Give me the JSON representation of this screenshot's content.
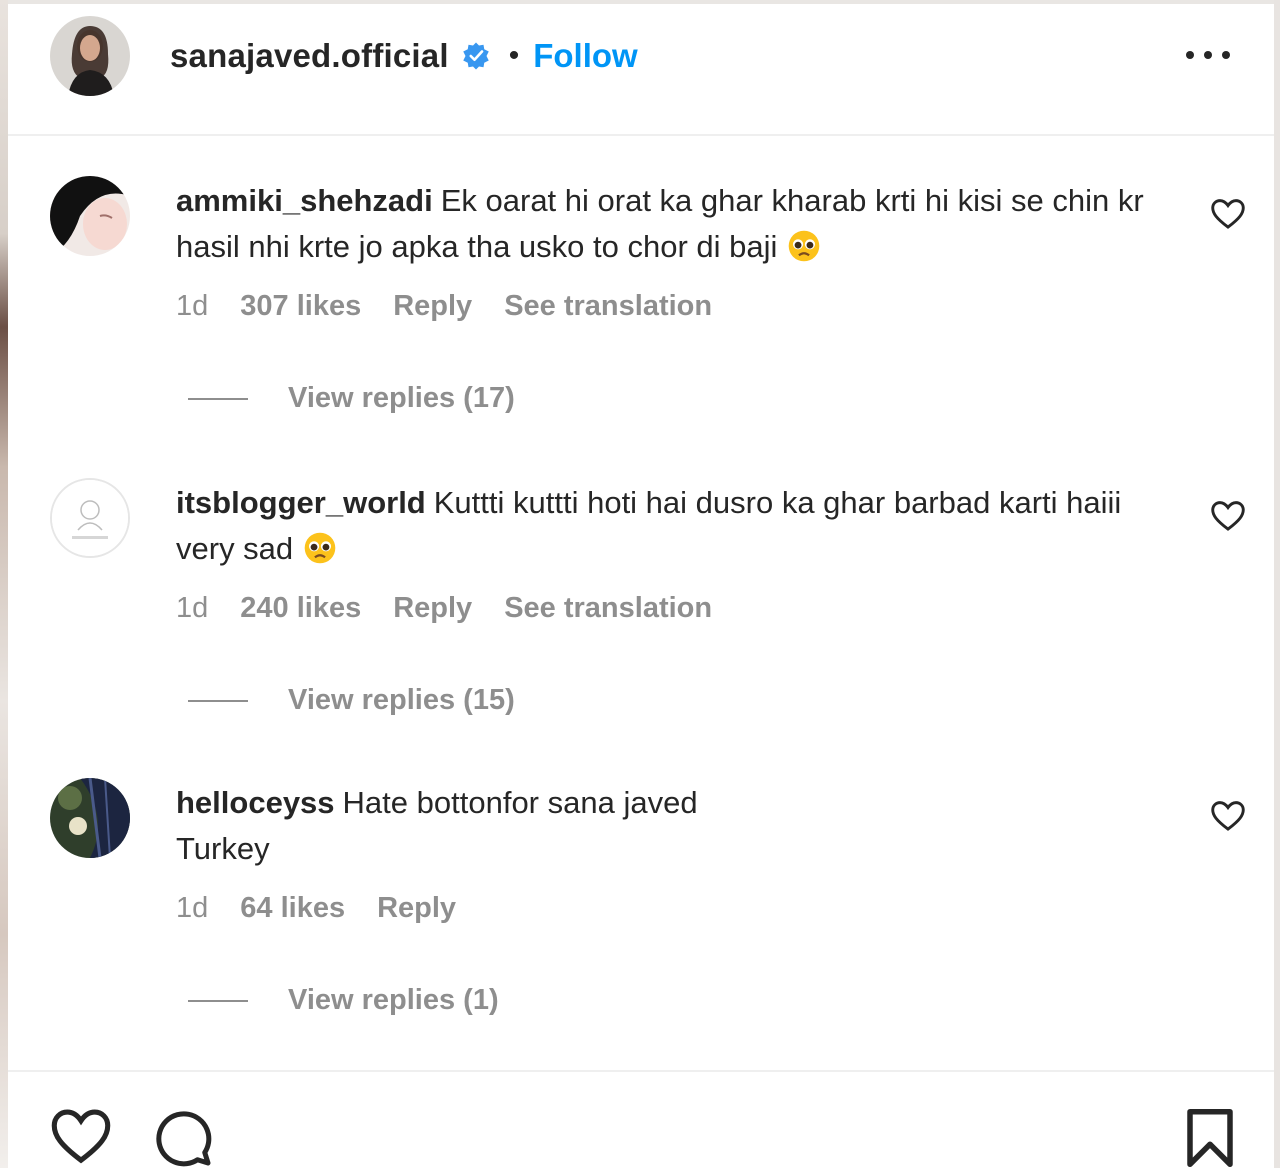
{
  "header": {
    "username": "sanajaved.official",
    "separator": "•",
    "follow_label": "Follow",
    "verified_icon": "verified-badge-icon",
    "more_icon": "more-options-icon"
  },
  "comments": [
    {
      "username": "ammiki_shehzadi",
      "text": "Ek oarat hi orat ka ghar kharab krti hi kisi se chin kr hasil nhi krte jo apka tha usko to chor di baji",
      "emoji": "pleading-face",
      "time": "1d",
      "likes": "307 likes",
      "reply_label": "Reply",
      "translation_label": "See translation",
      "view_replies": "View replies (17)"
    },
    {
      "username": "itsblogger_world",
      "text": "Kuttti kuttti hoti hai dusro ka ghar barbad karti haiii very sad",
      "emoji": "pleading-face",
      "time": "1d",
      "likes": "240 likes",
      "reply_label": "Reply",
      "translation_label": "See translation",
      "view_replies": "View replies (15)"
    },
    {
      "username": "helloceyss",
      "text_line1": "Hate bottonfor sana javed",
      "text_line2": "Turkey",
      "time": "1d",
      "likes": "64 likes",
      "reply_label": "Reply",
      "view_replies": "View replies (1)"
    }
  ],
  "actions": {
    "like_icon": "heart-icon",
    "comment_icon": "comment-icon",
    "save_icon": "bookmark-icon"
  },
  "colors": {
    "follow": "#0095f6",
    "muted": "#8e8e8e",
    "text": "#262626",
    "verified": "#3897f0"
  }
}
